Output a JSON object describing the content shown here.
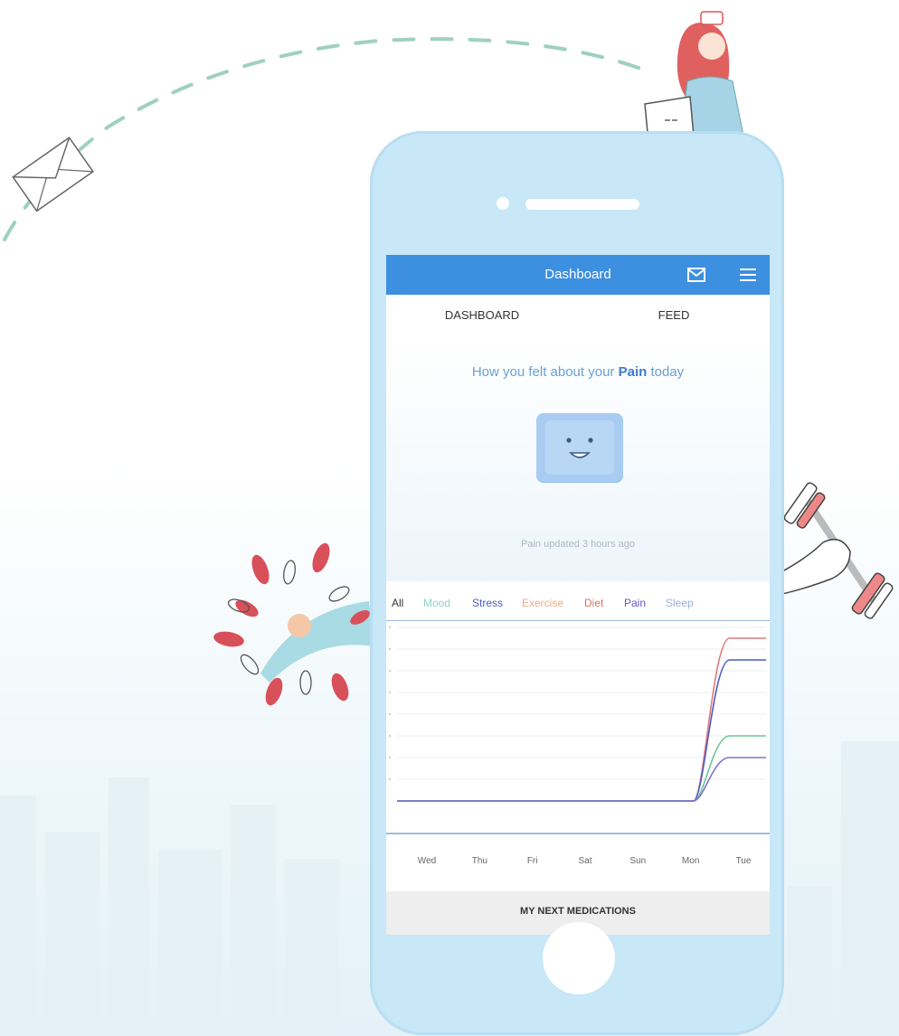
{
  "header": {
    "title": "Dashboard"
  },
  "tabs": [
    {
      "label": "DASHBOARD"
    },
    {
      "label": "FEED"
    }
  ],
  "hero": {
    "headline_prefix": "How you felt about your ",
    "headline_highlight": "Pain",
    "headline_suffix": " today",
    "update_text": "Pain updated 3 hours ago"
  },
  "filters": [
    {
      "label": "All",
      "color": "#333333"
    },
    {
      "label": "Mood",
      "color": "#8fd3c8"
    },
    {
      "label": "Stress",
      "color": "#4a5cc8"
    },
    {
      "label": "Exercise",
      "color": "#f0a98a"
    },
    {
      "label": "Diet",
      "color": "#e0705c"
    },
    {
      "label": "Pain",
      "color": "#6b52c9"
    },
    {
      "label": "Sleep",
      "color": "#9ab2d8"
    }
  ],
  "chart_data": {
    "type": "line",
    "categories": [
      "Wed",
      "Thu",
      "Fri",
      "Sat",
      "Sun",
      "Mon",
      "Tue"
    ],
    "series": [
      {
        "color": "#e37878",
        "values": [
          0,
          0,
          0,
          0,
          0,
          0,
          7.5
        ]
      },
      {
        "color": "#4a5cc8",
        "values": [
          0,
          0,
          0,
          0,
          0,
          0,
          6.5
        ]
      },
      {
        "color": "#6cc79a",
        "values": [
          0,
          0,
          0,
          0,
          0,
          0,
          3.0
        ]
      },
      {
        "color": "#7b70cf",
        "values": [
          0,
          0,
          0,
          0,
          0,
          0,
          2.0
        ]
      }
    ],
    "ylim": [
      0,
      8
    ],
    "grid": true
  },
  "medications": {
    "title": "MY NEXT MEDICATIONS"
  }
}
